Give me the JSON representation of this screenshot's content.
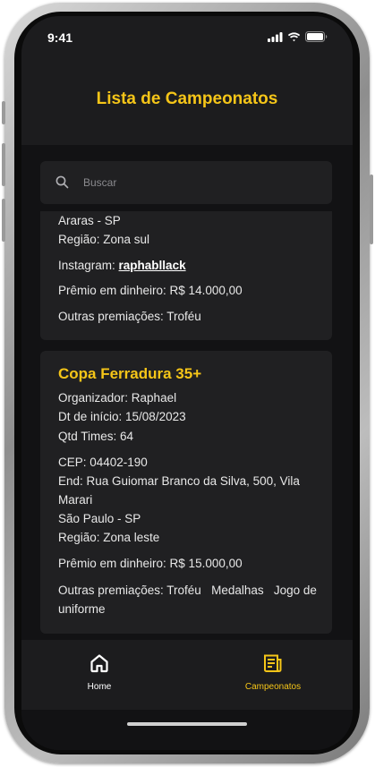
{
  "status_bar": {
    "time": "9:41"
  },
  "header": {
    "title": "Lista de Campeonatos"
  },
  "search": {
    "placeholder": "Buscar",
    "icon": "search-icon"
  },
  "cards": [
    {
      "lines": {
        "city": "Araras - SP",
        "region": "Região: Zona sul",
        "instagram_label": "Instagram:",
        "instagram_handle": "raphabllack",
        "prize": "Prêmio em dinheiro: R$ 14.000,00",
        "other_prizes": "Outras premiações: Troféu"
      }
    },
    {
      "title": "Copa Ferradura 35+",
      "lines": {
        "organizer": "Organizador: Raphael",
        "start_date": "Dt de início: 15/08/2023",
        "teams": "Qtd Times: 64",
        "cep": "CEP: 04402-190",
        "address": "End: Rua Guiomar Branco da Silva, 500, Vila Marari",
        "city": "São Paulo - SP",
        "region": "Região: Zona leste",
        "prize": "Prêmio em dinheiro: R$ 15.000,00",
        "other_prizes": "Outras premiações: Troféu   Medalhas   Jogo de uniforme"
      }
    }
  ],
  "tabbar": {
    "home": {
      "label": "Home",
      "icon": "home-icon"
    },
    "championships": {
      "label": "Campeonatos",
      "icon": "newspaper-icon",
      "active": true
    }
  },
  "colors": {
    "accent": "#f5c518",
    "background": "#121214",
    "card": "#202022",
    "header": "#1c1c1e"
  }
}
